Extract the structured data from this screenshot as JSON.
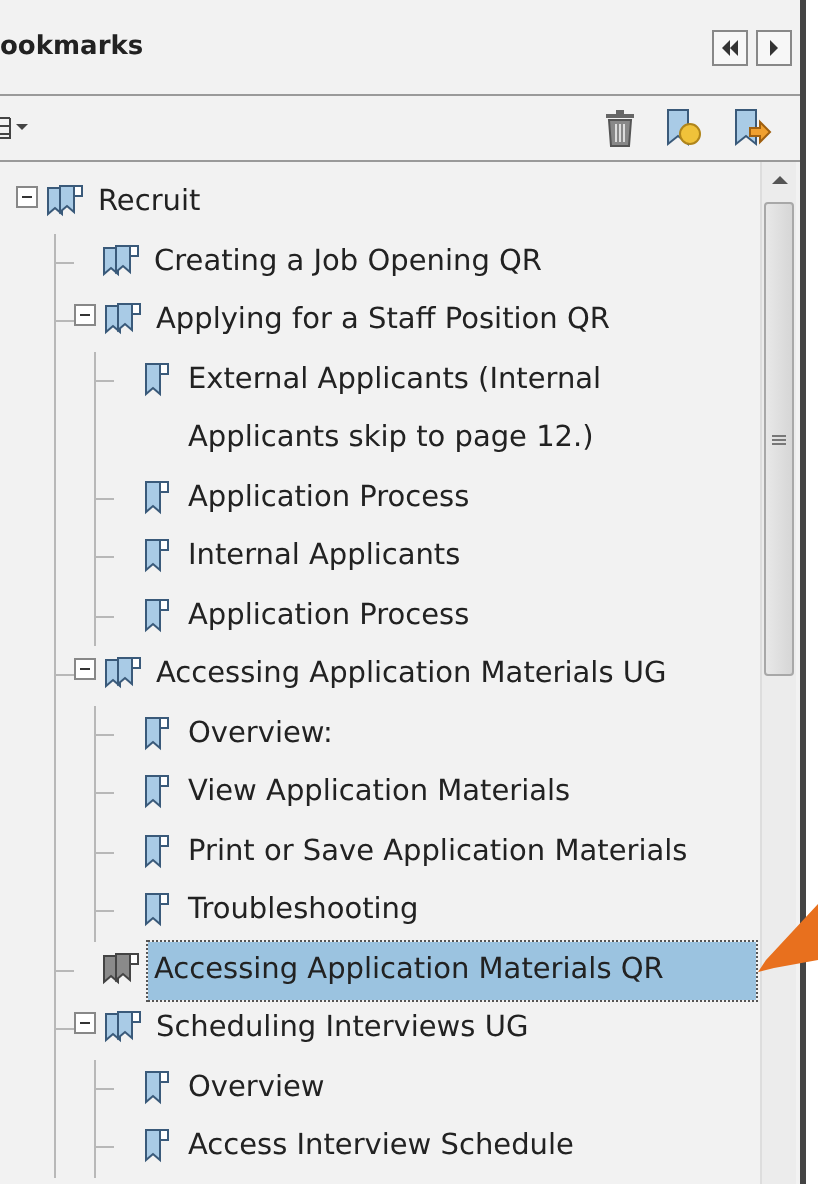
{
  "panel": {
    "title": "ookmarks"
  },
  "tree": [
    {
      "label": "Recruit",
      "kind": "group",
      "selected": false,
      "expanded": true,
      "children": [
        {
          "label": "Creating a Job Opening QR",
          "kind": "group",
          "selected": false
        },
        {
          "label": "Applying for a Staff Position QR",
          "kind": "group",
          "selected": false,
          "expanded": true,
          "children": [
            {
              "label": "External Applicants (Internal Applicants skip to page 12.)",
              "kind": "single",
              "selected": false
            },
            {
              "label": "Application Process",
              "kind": "single",
              "selected": false
            },
            {
              "label": "Internal Applicants",
              "kind": "single",
              "selected": false
            },
            {
              "label": "Application Process",
              "kind": "single",
              "selected": false
            }
          ]
        },
        {
          "label": "Accessing Application Materials UG",
          "kind": "group",
          "selected": false,
          "expanded": true,
          "children": [
            {
              "label": "Overview:",
              "kind": "single",
              "selected": false
            },
            {
              "label": "View Application Materials",
              "kind": "single",
              "selected": false
            },
            {
              "label": "Print or Save Application Materials",
              "kind": "single",
              "selected": false
            },
            {
              "label": "Troubleshooting",
              "kind": "single",
              "selected": false
            }
          ]
        },
        {
          "label": "Accessing Application Materials QR",
          "kind": "group",
          "selected": true
        },
        {
          "label": "Scheduling Interviews UG",
          "kind": "group",
          "selected": false,
          "expanded": true,
          "children": [
            {
              "label": "Overview",
              "kind": "single",
              "selected": false
            },
            {
              "label": "Access Interview Schedule",
              "kind": "single",
              "selected": false
            }
          ]
        }
      ]
    }
  ]
}
